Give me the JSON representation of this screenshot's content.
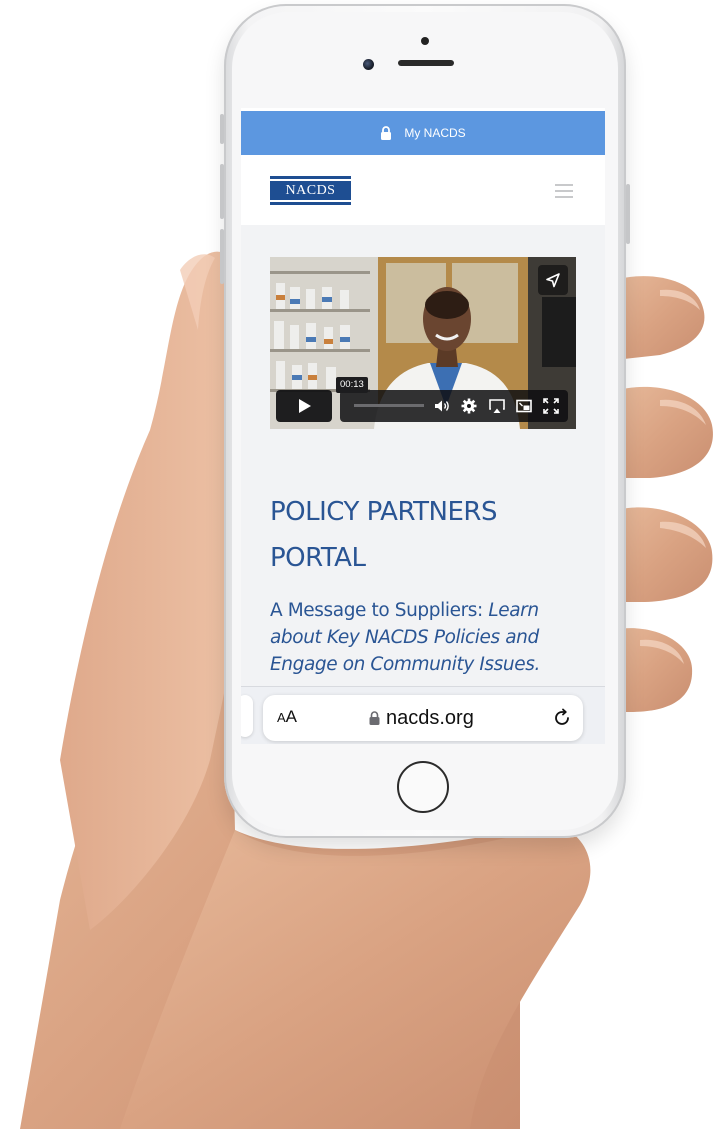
{
  "top_bar": {
    "label": "My NACDS",
    "icon": "lock-icon",
    "color": "#5c97e0"
  },
  "header": {
    "logo_text": "NACDS",
    "menu_icon": "hamburger-menu-icon",
    "logo_color": "#1e4e92"
  },
  "video": {
    "time": "00:13",
    "controls": [
      "play-icon",
      "volume-icon",
      "settings-icon",
      "airplay-icon",
      "picture-in-picture-icon",
      "fullscreen-icon"
    ],
    "share_icon": "share-icon"
  },
  "main": {
    "title_line1": "POLICY PARTNERS",
    "title_line2": "PORTAL",
    "subtitle_lead": "A Message to Suppliers: ",
    "subtitle_emphasis_1": "Learn about Key NACDS Policies and",
    "subtitle_emphasis_2": "Engage on Community Issues.",
    "text_color": "#2a5594"
  },
  "browser": {
    "text_size_button_small": "A",
    "text_size_button_large": "A",
    "url": "nacds.org",
    "reload_icon": "reload-icon"
  }
}
